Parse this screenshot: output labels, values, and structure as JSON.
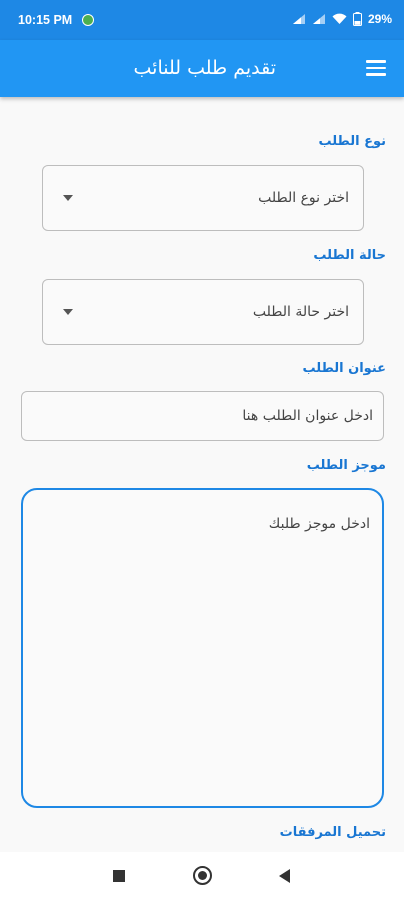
{
  "status_bar": {
    "time": "10:15 PM",
    "battery": "29"
  },
  "app_bar": {
    "title": "تقديم طلب للنائب",
    "menu_icon": "hamburger-menu-icon"
  },
  "form": {
    "request_type": {
      "label": "نوع الطلب",
      "value": "اختر نوع الطلب"
    },
    "request_status": {
      "label": "حالة الطلب",
      "value": "اختر حالة الطلب"
    },
    "request_title": {
      "label": "عنوان الطلب",
      "placeholder": "ادخل عنوان الطلب هنا"
    },
    "request_summary": {
      "label": "موجز الطلب",
      "placeholder": "ادخل موجز طلبك"
    },
    "attachments": {
      "label": "تحميل المرفقات"
    }
  },
  "colors": {
    "primary": "#2196f3",
    "accent": "#1e88e5",
    "label": "#1976d2"
  }
}
